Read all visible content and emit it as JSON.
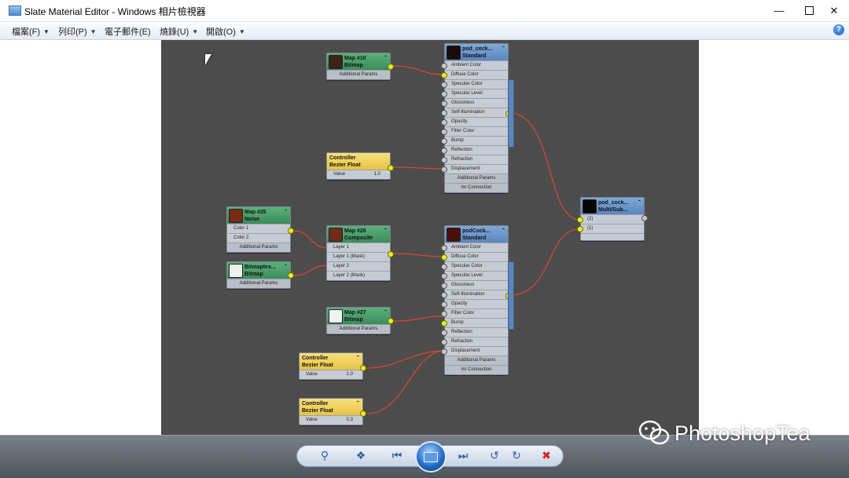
{
  "window": {
    "title": "Slate Material Editor - Windows 相片檢視器"
  },
  "menu": [
    {
      "label": "檔案(F)"
    },
    {
      "label": "列印(P)"
    },
    {
      "label": "電子郵件(E)"
    },
    {
      "label": "燒錄(U)"
    },
    {
      "label": "開啟(O)"
    }
  ],
  "nodes": {
    "map10": {
      "name": "Map #10",
      "type": "Bitmap",
      "swatch": "#3a2418",
      "sub": "Additional Params"
    },
    "standard1": {
      "name": "pod_cock...",
      "type": "Standard",
      "swatch": "#1a0a0a",
      "slots": [
        "Ambient Color",
        "Diffuse Color",
        "Specular Color",
        "Specular Level",
        "Glossiness",
        "Self-Illumination",
        "Opacity",
        "Filter Color",
        "Bump",
        "Reflection",
        "Refraction",
        "Displacement"
      ],
      "sub1": "Additional Params",
      "sub2": "mr Connection"
    },
    "ctrl1": {
      "name": "Controller",
      "type": "Bezier Float",
      "value_label": "Value",
      "value": "1.0"
    },
    "map25": {
      "name": "Map #25",
      "type": "Noise",
      "swatch": "#7a2a16",
      "slots": [
        "Color 1",
        "Color 2"
      ],
      "sub": "Additional Params"
    },
    "map26": {
      "name": "Map #26",
      "type": "Composite",
      "swatch": "#6e2a1a",
      "slots": [
        "Layer 1",
        "Layer 1 (Mask)",
        "Layer 2",
        "Layer 2 (Mask)"
      ]
    },
    "bitmap2": {
      "name": "Bitmaptex...",
      "type": "Bitmap",
      "swatch": "#eef1f0",
      "sub": "Additional Params"
    },
    "standard2": {
      "name": "podCock...",
      "type": "Standard",
      "swatch": "#4a1010",
      "slots": [
        "Ambient Color",
        "Diffuse Color",
        "Specular Color",
        "Specular Level",
        "Glossiness",
        "Self-Illumination",
        "Opacity",
        "Filter Color",
        "Bump",
        "Reflection",
        "Refraction",
        "Displacement"
      ],
      "sub1": "Additional Params",
      "sub2": "mr Connection"
    },
    "map27": {
      "name": "Map #27",
      "type": "Bitmap",
      "swatch": "#f1f3f2",
      "sub": "Additional Params"
    },
    "ctrl2": {
      "name": "Controller",
      "type": "Bezier Float",
      "value_label": "Value",
      "value": "1.0"
    },
    "ctrl3": {
      "name": "Controller",
      "type": "Bezier Float",
      "value_label": "Value",
      "value": "0.3"
    },
    "multi": {
      "name": "pod_cock...",
      "type": "Multi/Sub...",
      "swatch": "#050505",
      "slots": [
        "(2)",
        "(1)"
      ]
    }
  },
  "watermark": {
    "text": "PhotoshopTea"
  },
  "colors": {
    "canvas": "#4c4c4c",
    "wire": "#e0462e",
    "port_active": "#e7ef24",
    "header_green": "#4a9e6a",
    "header_blue": "#6b97cc",
    "header_yellow": "#f0d25c"
  }
}
